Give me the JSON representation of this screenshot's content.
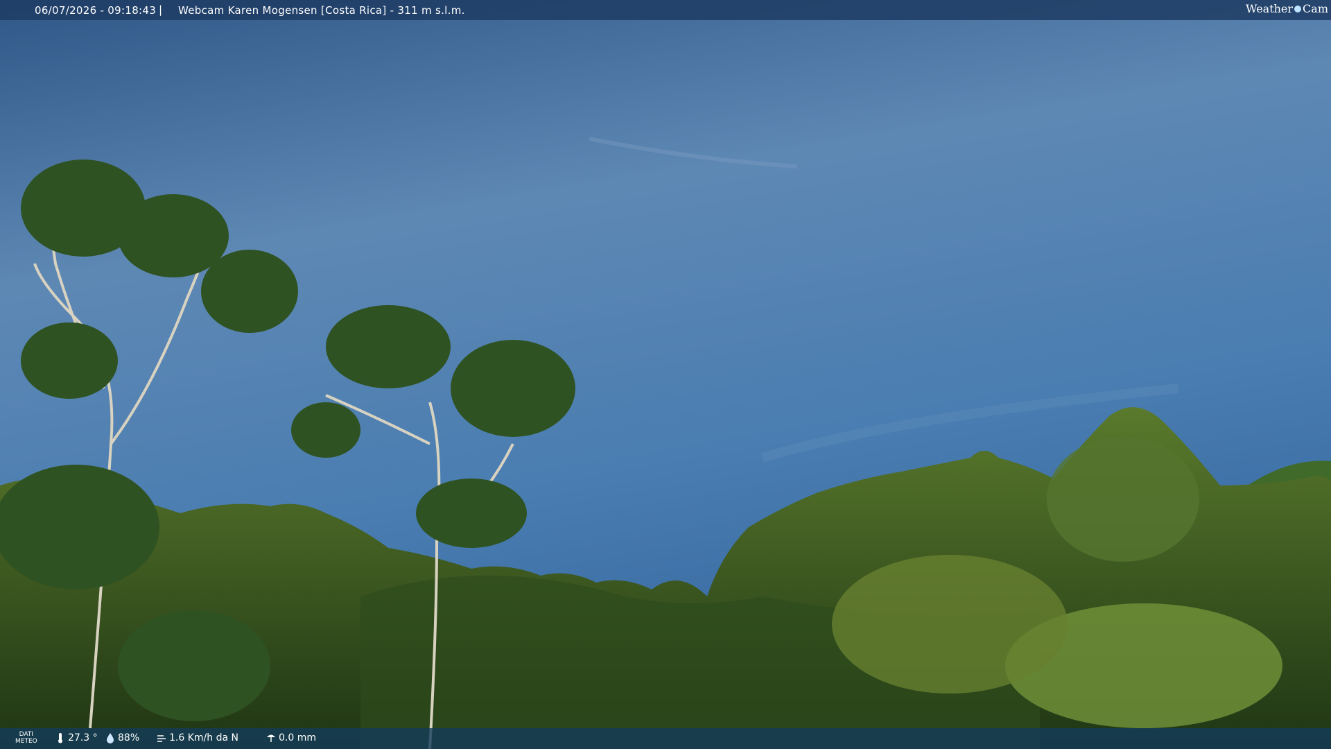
{
  "header": {
    "datetime": "06/07/2026 - 09:18:43",
    "separator": "|",
    "title": "Webcam Karen Mogensen [Costa Rica]  - 311 m s.l.m.",
    "logo_left": "Weather",
    "logo_right": "Cam"
  },
  "footer": {
    "label_line1": "DATI",
    "label_line2": "METEO",
    "temperature": "27.3 °",
    "humidity": "88%",
    "wind": "1.6 Km/h da N",
    "rain": "0.0 mm",
    "icons": [
      "thermometer-icon",
      "humidity-icon",
      "wind-icon",
      "rain-icon"
    ]
  },
  "colors": {
    "sky_top": "#2f5787",
    "sky_mid": "#5b86b3",
    "sky_bottom": "#3d73aa",
    "foliage_dark": "#2b4a1e",
    "foliage_light": "#6b8c36"
  }
}
